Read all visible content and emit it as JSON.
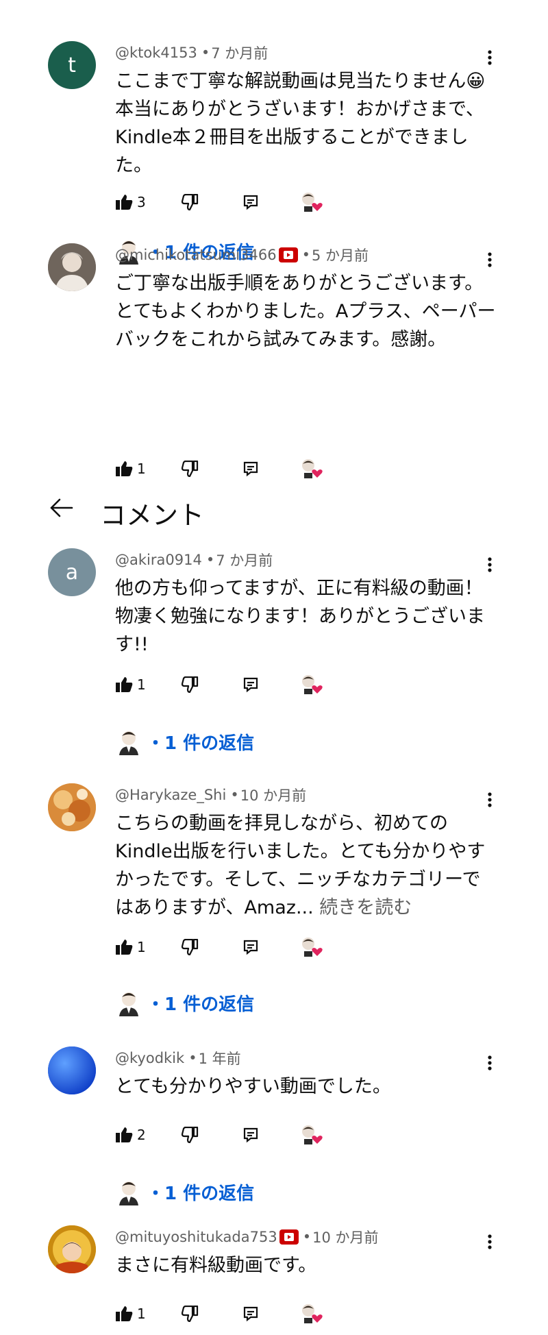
{
  "header": {
    "title": "コメント"
  },
  "comments": [
    {
      "avatar_letter": "t",
      "avatar_color": "#1a5e4c",
      "handle": "@ktok4153",
      "time": "7 か月前",
      "text": "ここまで丁寧な解説動画は見当たりません😀本当にありがとうざいます！おかげさまで、Kindle本２冊目を出版することができました。",
      "likes": "3",
      "replies_label": "・1 件の返信"
    },
    {
      "avatar_letter": "",
      "avatar_color": "#9a8f86",
      "handle": "@michikotatsumi3466",
      "time": "5 か月前",
      "text": "ご丁寧な出版手順をありがとうございます。とてもよくわかりました。Aプラス、ペーパーバックをこれから試みてみます。感謝。",
      "likes": "1"
    },
    {
      "avatar_letter": "a",
      "avatar_color": "#78909c",
      "handle": "@akira0914",
      "time": "7 か月前",
      "text": "他の方も仰ってますが、正に有料級の動画！物凄く勉強になります！ありがとうございます!!",
      "likes": "1",
      "replies_label": "・1 件の返信"
    },
    {
      "avatar_letter": "",
      "avatar_color": "#e0a050",
      "handle": "@Harykaze_Shi",
      "time": "10 か月前",
      "text": "こちらの動画を拝見しながら、初めてのKindle出版を行いました。とても分かりやすかったです。そして、ニッチなカテゴリーではありますが、Amaz...",
      "read_more": "続きを読む",
      "likes": "1",
      "replies_label": "・1 件の返信"
    },
    {
      "avatar_letter": "",
      "avatar_color": "#1e5ee0",
      "handle": "@kyodkik",
      "time": "1 年前",
      "text": "とても分かりやすい動画でした。",
      "likes": "2",
      "replies_label": "・1 件の返信"
    },
    {
      "avatar_letter": "",
      "avatar_color": "#d9a020",
      "handle": "@mituyoshitukada753",
      "time": "10 か月前",
      "text": "まさに有料級動画です。",
      "likes": "1"
    }
  ],
  "colors": {
    "link": "#065fd4",
    "meta": "#606060",
    "badge": "#cc0000",
    "heart": "#e0245e"
  }
}
